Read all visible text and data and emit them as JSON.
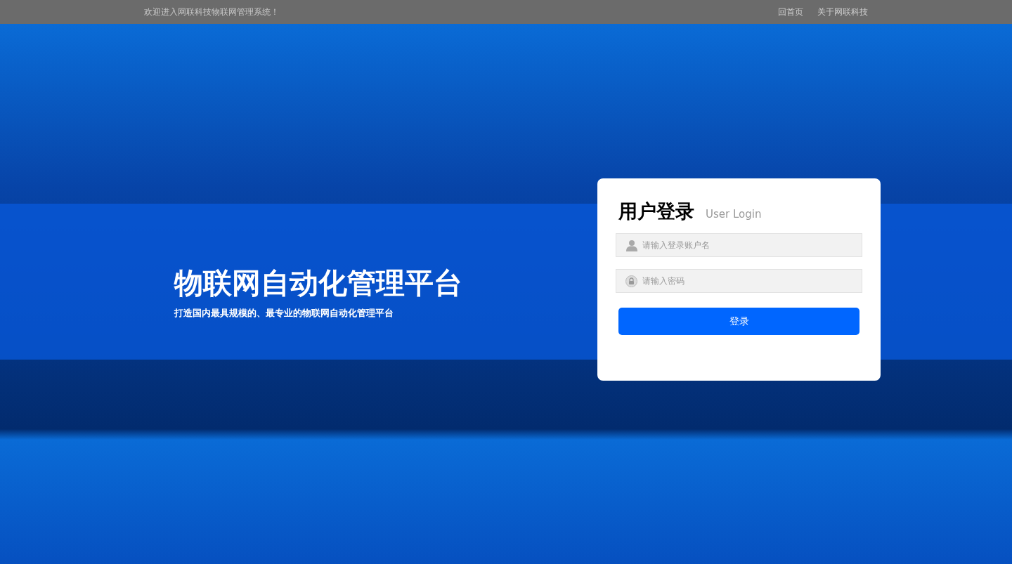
{
  "top_bar": {
    "welcome": "欢迎进入网联科技物联网管理系统！",
    "links": [
      "回首页",
      "关于网联科技"
    ]
  },
  "banner": {
    "title": "物联网自动化管理平台",
    "subtitle": "打造国内最具规模的、最专业的物联网自动化管理平台"
  },
  "login": {
    "title": "用户登录",
    "subtitle": "User Login",
    "username": {
      "placeholder": "请输入登录账户名"
    },
    "password": {
      "placeholder": "请输入密码"
    },
    "button": "登录"
  }
}
